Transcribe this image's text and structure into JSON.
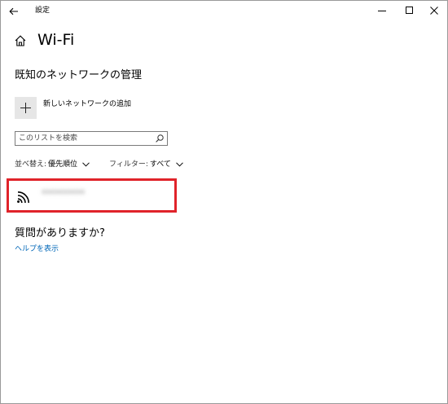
{
  "window": {
    "title": "設定"
  },
  "header": {
    "page_title": "Wi-Fi"
  },
  "known_networks": {
    "section_title": "既知のネットワークの管理",
    "add_network_label": "新しいネットワークの追加",
    "search": {
      "placeholder": "このリストを検索",
      "value": ""
    },
    "sort": {
      "label": "並べ替え:",
      "value": "優先順位"
    },
    "filter": {
      "label": "フィルター:",
      "value": "すべて"
    },
    "networks": [
      {
        "name": "xxxxxxxxxx",
        "icon": "wifi-signal-icon",
        "highlight_color": "#e0232a"
      }
    ]
  },
  "help": {
    "title": "質問がありますか?",
    "link_label": "ヘルプを表示"
  },
  "colors": {
    "link": "#0067b8",
    "highlight": "#e0232a",
    "tile": "#e6e6e6"
  }
}
